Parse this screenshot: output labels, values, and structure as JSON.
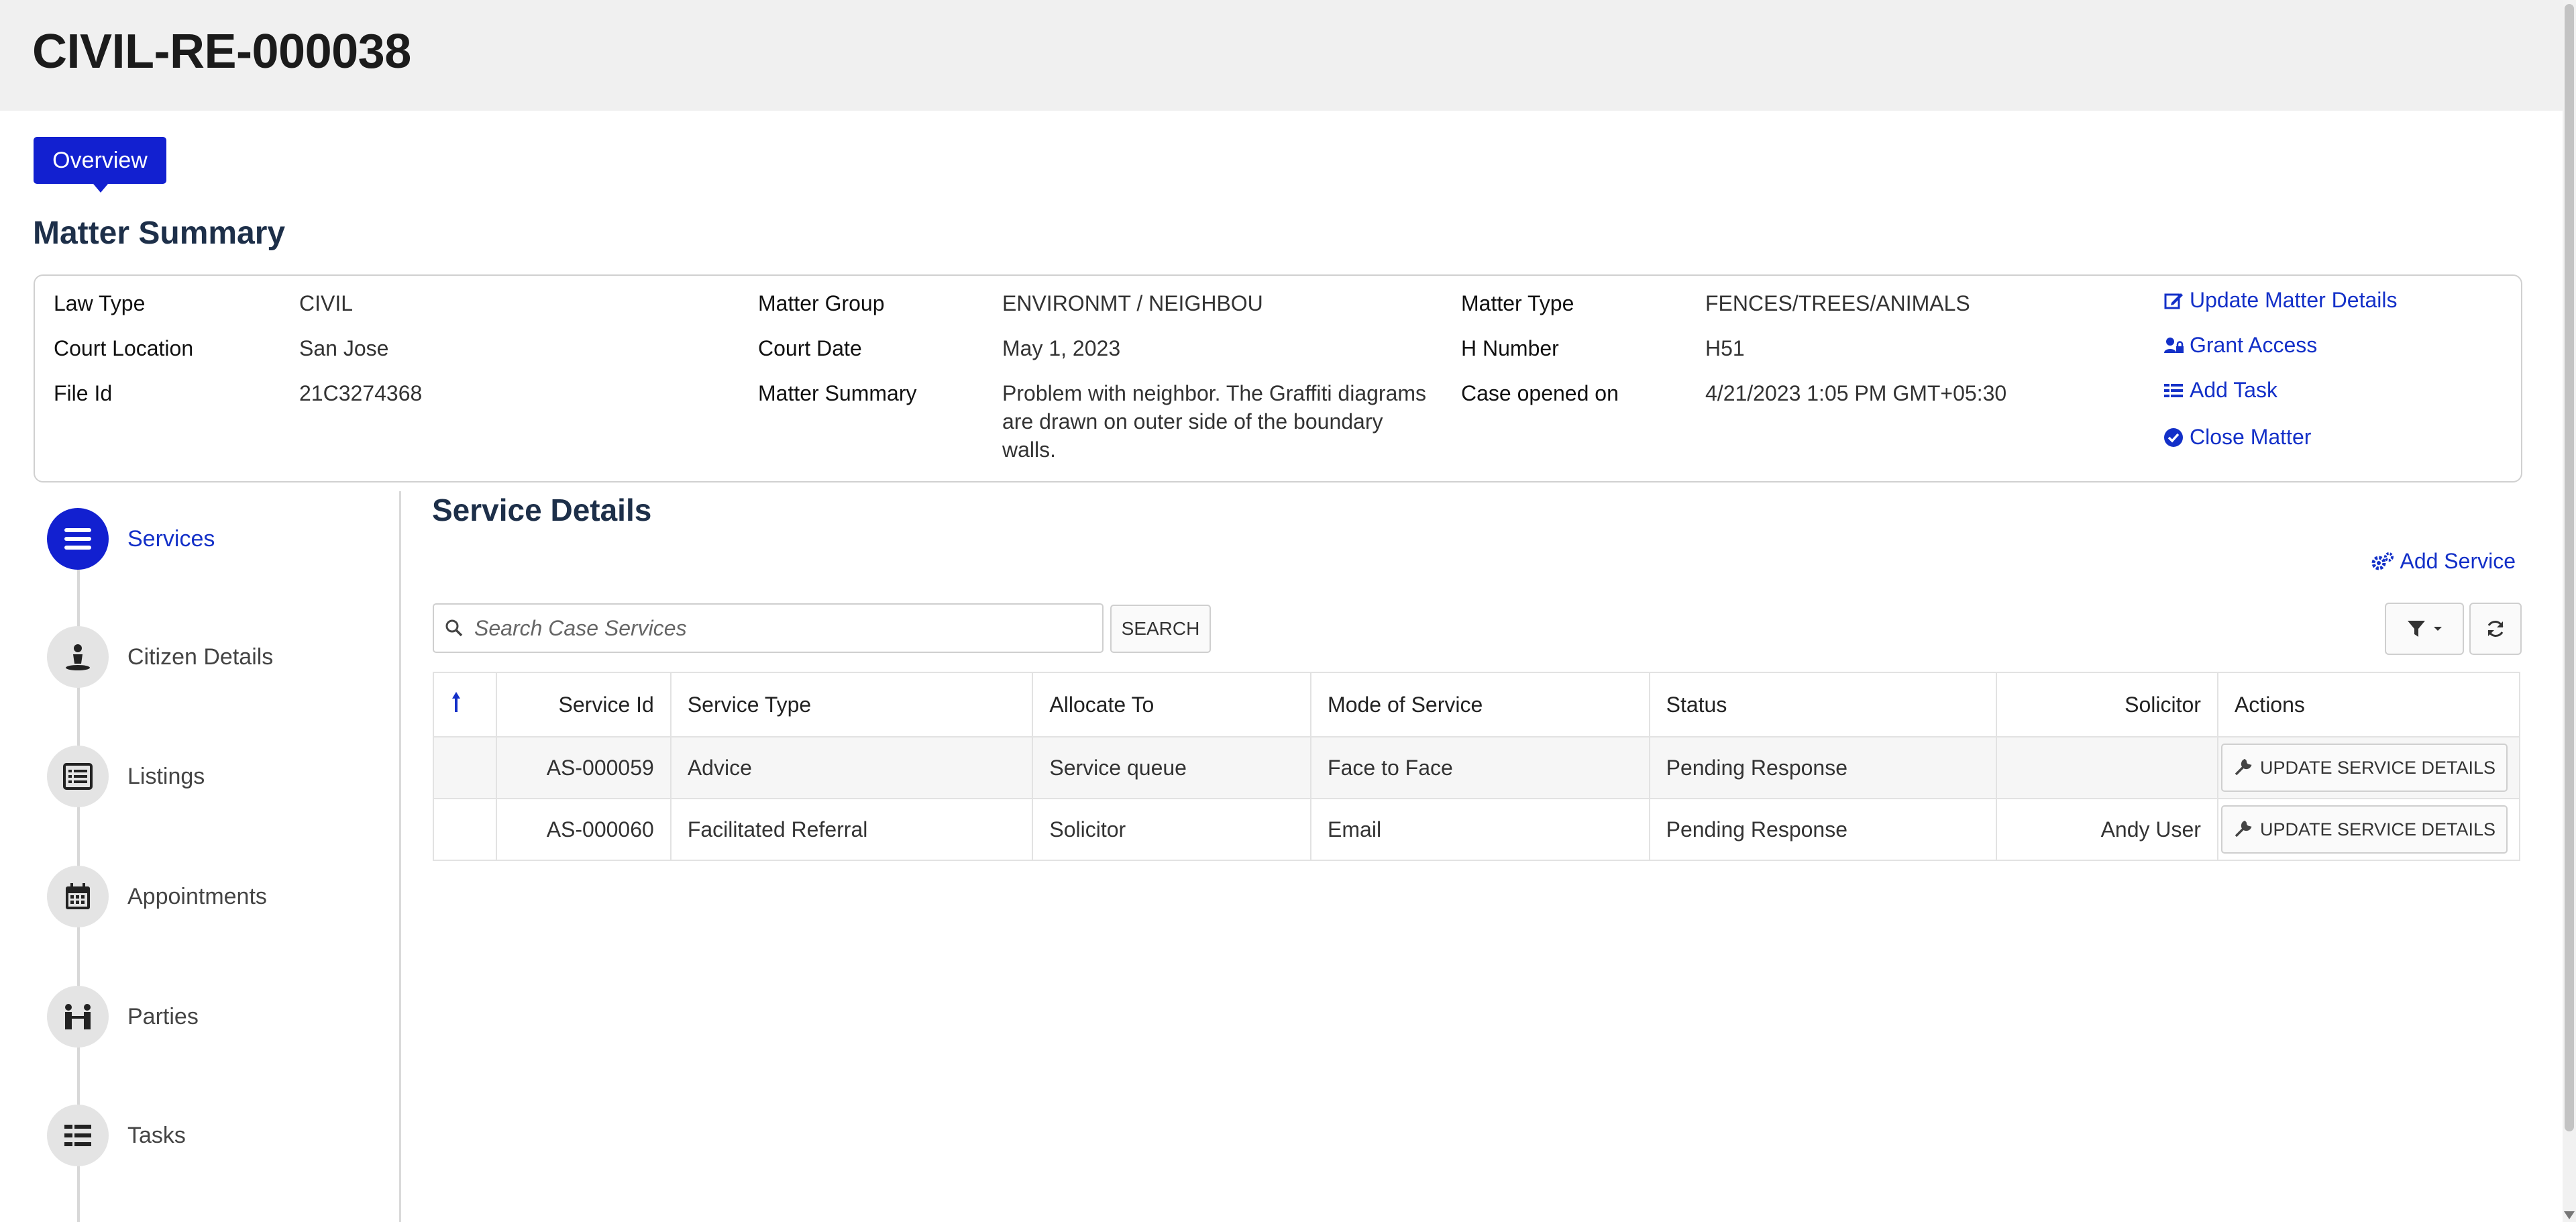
{
  "header": {
    "title": "CIVIL-RE-000038"
  },
  "tabs": [
    {
      "label": "Overview",
      "active": true
    }
  ],
  "matter_summary": {
    "title": "Matter Summary",
    "fields": {
      "law_type": {
        "label": "Law Type",
        "value": "CIVIL"
      },
      "court_location": {
        "label": "Court Location",
        "value": "San Jose"
      },
      "file_id": {
        "label": "File Id",
        "value": "21C3274368"
      },
      "matter_group": {
        "label": "Matter Group",
        "value": "ENVIRONMT / NEIGHBOU"
      },
      "court_date": {
        "label": "Court Date",
        "value": "May 1, 2023"
      },
      "matter_summary": {
        "label": "Matter Summary",
        "value": "Problem with neighbor. The Graffiti diagrams are drawn on outer side of the boundary walls."
      },
      "matter_type": {
        "label": "Matter Type",
        "value": "FENCES/TREES/ANIMALS"
      },
      "h_number": {
        "label": "H Number",
        "value": "H51"
      },
      "case_opened_on": {
        "label": "Case opened on",
        "value": "4/21/2023 1:05 PM GMT+05:30"
      }
    },
    "actions": {
      "update": "Update Matter Details",
      "grant": "Grant Access",
      "add_task": "Add Task",
      "close": "Close Matter"
    }
  },
  "nav": {
    "items": [
      {
        "label": "Services",
        "icon": "list-icon",
        "active": true
      },
      {
        "label": "Citizen Details",
        "icon": "person-icon"
      },
      {
        "label": "Listings",
        "icon": "listing-icon"
      },
      {
        "label": "Appointments",
        "icon": "calendar-icon"
      },
      {
        "label": "Parties",
        "icon": "parties-icon"
      },
      {
        "label": "Tasks",
        "icon": "tasks-icon"
      }
    ]
  },
  "services": {
    "title": "Service Details",
    "add_label": "Add Service",
    "search_placeholder": "Search Case Services",
    "search_button": "SEARCH",
    "sort_icon": "sort-up-icon",
    "columns": [
      "Service Id",
      "Service Type",
      "Allocate To",
      "Mode of Service",
      "Status",
      "Solicitor",
      "Actions"
    ],
    "rows": [
      {
        "service_id": "AS-000059",
        "service_type": "Advice",
        "allocate_to": "Service queue",
        "mode": "Face to Face",
        "status": "Pending Response",
        "solicitor": "",
        "action": "UPDATE SERVICE DETAILS"
      },
      {
        "service_id": "AS-000060",
        "service_type": "Facilitated Referral",
        "allocate_to": "Solicitor",
        "mode": "Email",
        "status": "Pending Response",
        "solicitor": "Andy User",
        "action": "UPDATE SERVICE DETAILS"
      }
    ]
  },
  "colors": {
    "accent": "#1220d0",
    "link": "#1330c8",
    "heading": "#1d2f49"
  }
}
